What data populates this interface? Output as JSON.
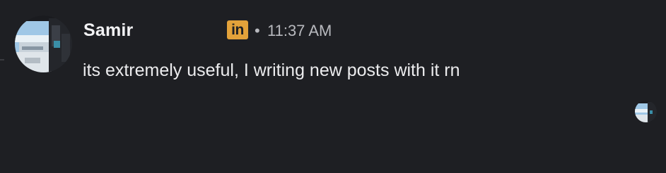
{
  "message": {
    "sender": "Samir",
    "badge_icon": "linkedin-icon",
    "badge_text": "in",
    "separator": "•",
    "timestamp": "11:37 AM",
    "text": "its extremely useful, I writing new posts with it rn"
  },
  "colors": {
    "background": "#1e1f23",
    "text": "#ececee",
    "muted_text": "#b8b9be",
    "badge": "#e3a23a"
  }
}
